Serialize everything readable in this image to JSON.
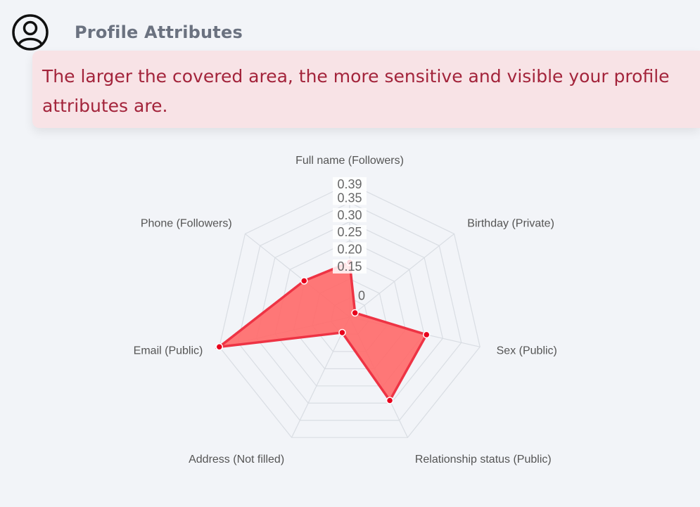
{
  "header": {
    "title": "Profile Attributes",
    "icon": "user-circle-icon"
  },
  "alert": {
    "message": "The larger the covered area, the more sensitive and visible your profile attributes are."
  },
  "colors": {
    "fill": "#ff6b6b",
    "stroke": "#ee3344",
    "point": "#e8001c",
    "grid": "#d9dde3",
    "alert_bg": "#f8e3e6",
    "alert_text": "#a3243b"
  },
  "chart_data": {
    "type": "radar",
    "axes": [
      "Full name (Followers)",
      "Birthday (Private)",
      "Sex (Public)",
      "Relationship status (Public)",
      "Address (Not filled)",
      "Email (Public)",
      "Phone (Followers)"
    ],
    "values": [
      0.16,
      0.02,
      0.23,
      0.27,
      0.05,
      0.39,
      0.17
    ],
    "scale_max": 0.39,
    "ticks": [
      0.15,
      0.2,
      0.25,
      0.3,
      0.35,
      0.39
    ],
    "tick_labels": [
      "0.15",
      "0.20",
      "0.25",
      "0.30",
      "0.35",
      "0.39"
    ],
    "partial_tick_label": "0",
    "grid": true
  }
}
